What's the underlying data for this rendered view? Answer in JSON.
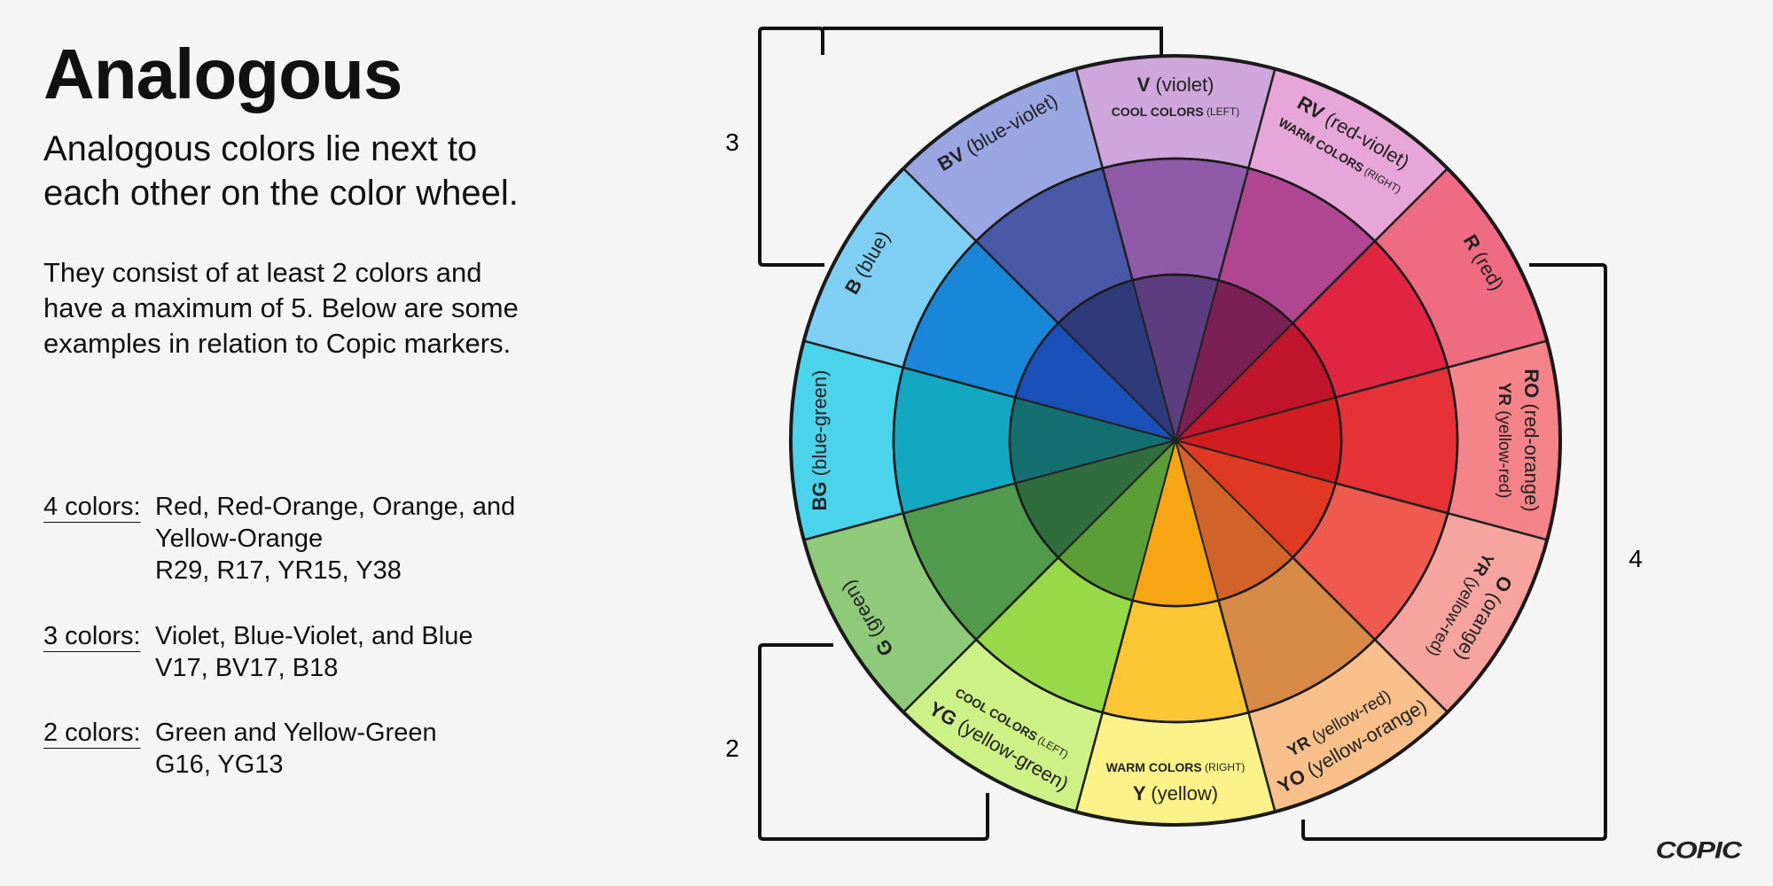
{
  "title": "Analogous",
  "subtitle_lines": [
    "Analogous colors lie next to",
    "each other on the color wheel."
  ],
  "description_lines": [
    "They consist of at least 2 colors and",
    "have a maximum of 5. Below are some",
    "examples in relation to Copic markers."
  ],
  "examples": [
    {
      "label": "4 colors",
      "lines": [
        "Red, Red-Orange, Orange, and",
        "Yellow-Orange",
        "R29, R17, YR15, Y38"
      ]
    },
    {
      "label": "3 colors",
      "lines": [
        "Violet, Blue-Violet, and Blue",
        "V17, BV17, B18"
      ]
    },
    {
      "label": "2 colors",
      "lines": [
        "Green and Yellow-Green",
        "G16, YG13"
      ]
    }
  ],
  "bracket_labels": {
    "three": "3",
    "four": "4",
    "two": "2"
  },
  "wheel": {
    "segments": [
      {
        "code": "V",
        "name": "(violet)",
        "note": "COOL COLORS (LEFT)",
        "outer": "#cfa6dc",
        "mid": "#8f5aa8",
        "inner": "#5e3c80"
      },
      {
        "code": "RV",
        "name": "(red-violet)",
        "note": "WARM COLORS (RIGHT)",
        "outer": "#e6a6d8",
        "mid": "#b04592",
        "inner": "#7c1f55"
      },
      {
        "code": "R",
        "name": "(red)",
        "note": "",
        "outer": "#ef6b82",
        "mid": "#e02642",
        "inner": "#c0142c"
      },
      {
        "code": "RO",
        "name": "(red-orange)",
        "code2": "YR",
        "name2": "(yellow-red)",
        "note": "",
        "outer": "#f4838a",
        "mid": "#e63237",
        "inner": "#d11d1f"
      },
      {
        "code": "O",
        "name": "(orange)",
        "code2": "YR",
        "name2": "(yellow-red)",
        "note": "",
        "outer": "#f7a3a0",
        "mid": "#f05a4e",
        "inner": "#e03a22"
      },
      {
        "code": "YO",
        "name": "(yellow-orange)",
        "code2": "YR",
        "name2": "(yellow-red)",
        "note": "",
        "outer": "#f9c08c",
        "mid": "#d78a45",
        "inner": "#d0622a"
      },
      {
        "code": "Y",
        "name": "(yellow)",
        "note": "WARM COLORS (RIGHT)",
        "outer": "#fbf38a",
        "mid": "#fcc635",
        "inner": "#f8a514"
      },
      {
        "code": "YG",
        "name": "(yellow-green)",
        "note": "COOL COLORS (LEFT)",
        "outer": "#cdf087",
        "mid": "#98d949",
        "inner": "#5b9e36"
      },
      {
        "code": "G",
        "name": "(green)",
        "note": "",
        "outer": "#8fc97a",
        "mid": "#4f9a4d",
        "inner": "#2f6e3c"
      },
      {
        "code": "BG",
        "name": "(blue-green)",
        "note": "",
        "outer": "#4cd3ec",
        "mid": "#12a8c2",
        "inner": "#156e70"
      },
      {
        "code": "B",
        "name": "(blue)",
        "note": "",
        "outer": "#7fcff5",
        "mid": "#1a86d8",
        "inner": "#1a4fb8"
      },
      {
        "code": "BV",
        "name": "(blue-violet)",
        "note": "",
        "outer": "#9aa6e2",
        "mid": "#4a58a8",
        "inner": "#2f3a7a"
      }
    ]
  },
  "logo": "COPIC"
}
